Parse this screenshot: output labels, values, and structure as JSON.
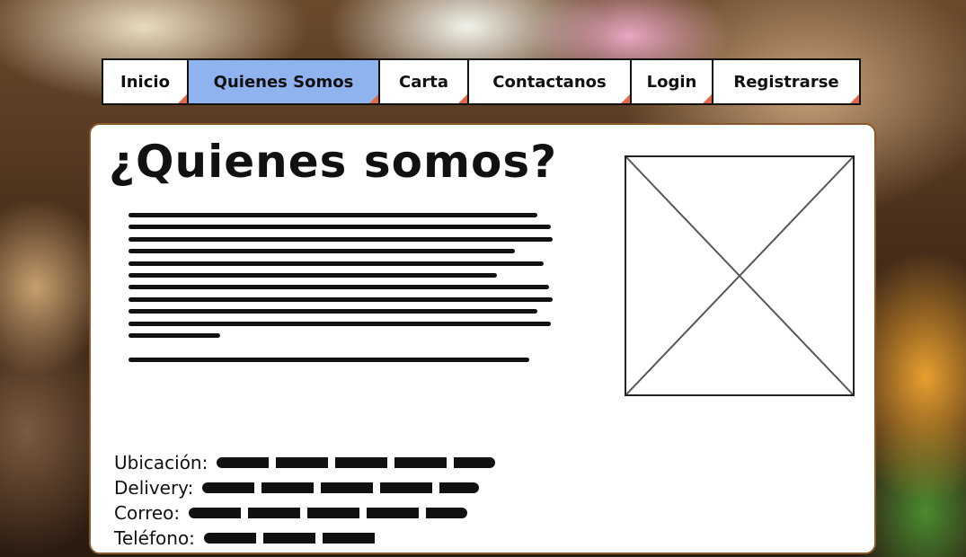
{
  "nav": {
    "items": [
      {
        "label": "Inicio",
        "active": false
      },
      {
        "label": "Quienes Somos",
        "active": true
      },
      {
        "label": "Carta",
        "active": false
      },
      {
        "label": "Contactanos",
        "active": false
      },
      {
        "label": "Login",
        "active": false
      },
      {
        "label": "Registrarse",
        "active": false
      }
    ]
  },
  "page": {
    "title": "¿Quienes somos?"
  },
  "info": {
    "ubicacion_label": "Ubicación:",
    "delivery_label": "Delivery:",
    "correo_label": "Correo:",
    "telefono_label": "Teléfono:"
  },
  "colors": {
    "nav_active": "#8fb3ee",
    "panel_border": "#8a5a2a"
  }
}
